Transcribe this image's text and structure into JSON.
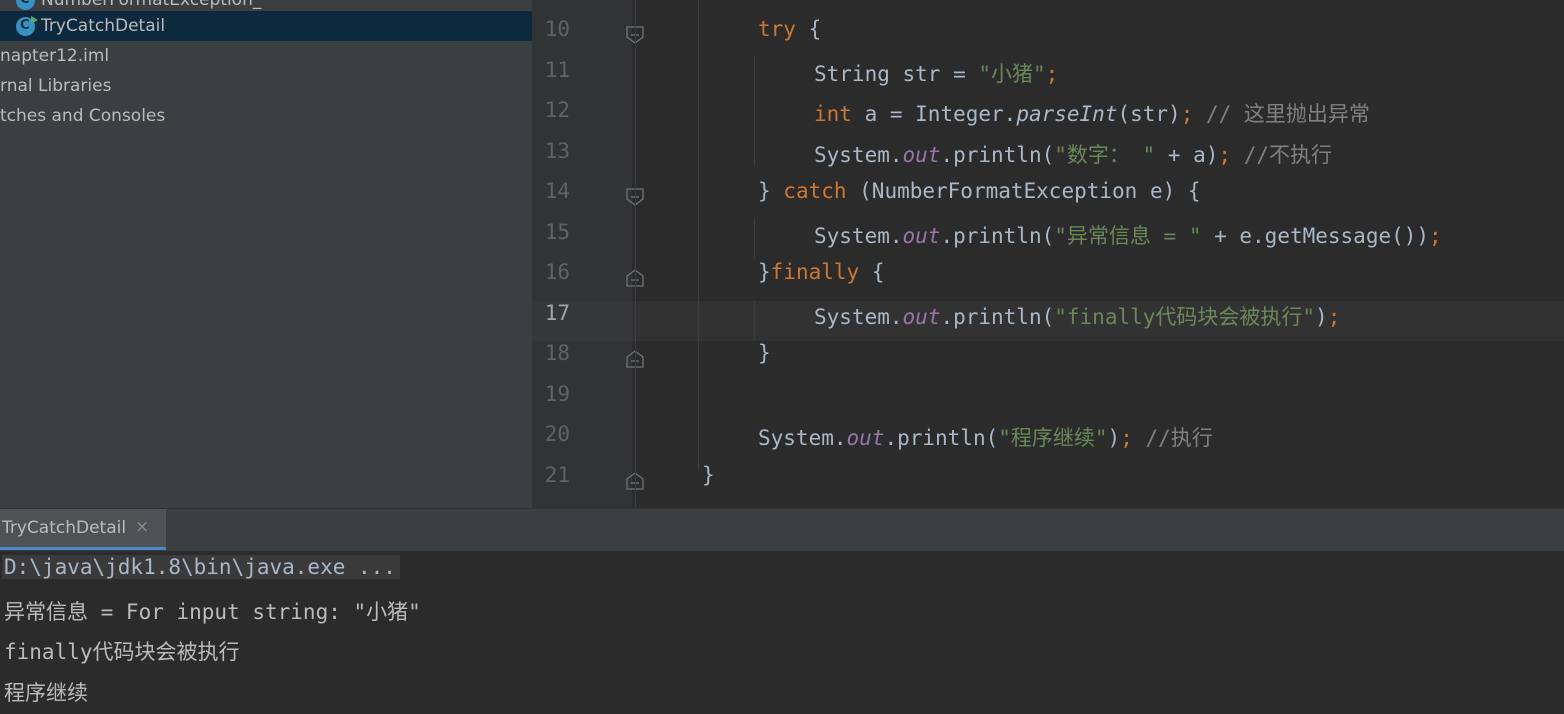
{
  "project_tree": {
    "items": [
      {
        "label": "NumberFormatException_",
        "kind": "class"
      },
      {
        "label": "TryCatchDetail",
        "kind": "class",
        "selected": true
      },
      {
        "label": "napter12.iml"
      },
      {
        "label": "rnal Libraries"
      },
      {
        "label": "tches and Consoles"
      }
    ]
  },
  "editor": {
    "current_line": 17,
    "lines": [
      {
        "num": "10",
        "tokens": [
          {
            "t": "try",
            "c": "kw"
          },
          {
            "t": " {",
            "c": ""
          }
        ]
      },
      {
        "num": "11",
        "tokens": [
          {
            "t": "String str = ",
            "c": ""
          },
          {
            "t": "\"小猪\"",
            "c": "str"
          },
          {
            "t": ";",
            "c": "semi"
          }
        ]
      },
      {
        "num": "12",
        "tokens": [
          {
            "t": "int",
            "c": "kw"
          },
          {
            "t": " a = Integer.",
            "c": ""
          },
          {
            "t": "parseInt",
            "c": "sm"
          },
          {
            "t": "(str)",
            "c": ""
          },
          {
            "t": ";",
            "c": "semi"
          },
          {
            "t": " // 这里抛出异常",
            "c": "cm"
          }
        ]
      },
      {
        "num": "13",
        "tokens": [
          {
            "t": "System.",
            "c": ""
          },
          {
            "t": "out",
            "c": "fld"
          },
          {
            "t": ".println(",
            "c": ""
          },
          {
            "t": "\"数字： \"",
            "c": "str"
          },
          {
            "t": " + a)",
            "c": ""
          },
          {
            "t": ";",
            "c": "semi"
          },
          {
            "t": " //不执行",
            "c": "cm"
          }
        ]
      },
      {
        "num": "14",
        "tokens": [
          {
            "t": "} ",
            "c": ""
          },
          {
            "t": "catch",
            "c": "kw"
          },
          {
            "t": " (NumberFormatException e) {",
            "c": ""
          }
        ]
      },
      {
        "num": "15",
        "tokens": [
          {
            "t": "System.",
            "c": ""
          },
          {
            "t": "out",
            "c": "fld"
          },
          {
            "t": ".println(",
            "c": ""
          },
          {
            "t": "\"异常信息 = \"",
            "c": "str"
          },
          {
            "t": " + e.getMessage())",
            "c": ""
          },
          {
            "t": ";",
            "c": "semi"
          }
        ]
      },
      {
        "num": "16",
        "tokens": [
          {
            "t": "}",
            "c": ""
          },
          {
            "t": "finally",
            "c": "kw"
          },
          {
            "t": " {",
            "c": ""
          }
        ]
      },
      {
        "num": "17",
        "tokens": [
          {
            "t": "System.",
            "c": ""
          },
          {
            "t": "out",
            "c": "fld"
          },
          {
            "t": ".println(",
            "c": ""
          },
          {
            "t": "\"finally代码块会被执行\"",
            "c": "str"
          },
          {
            "t": ")",
            "c": ""
          },
          {
            "t": ";",
            "c": "semi"
          }
        ]
      },
      {
        "num": "18",
        "tokens": [
          {
            "t": "}",
            "c": ""
          }
        ]
      },
      {
        "num": "19",
        "tokens": []
      },
      {
        "num": "20",
        "tokens": [
          {
            "t": "System.",
            "c": ""
          },
          {
            "t": "out",
            "c": "fld"
          },
          {
            "t": ".println(",
            "c": ""
          },
          {
            "t": "\"程序继续\"",
            "c": "str"
          },
          {
            "t": ")",
            "c": ""
          },
          {
            "t": ";",
            "c": "semi"
          },
          {
            "t": " //执行",
            "c": "cm"
          }
        ]
      },
      {
        "num": "21",
        "tokens": [
          {
            "t": "}",
            "c": ""
          }
        ]
      }
    ]
  },
  "run_panel": {
    "tab_label": "TryCatchDetail",
    "close_glyph": "×",
    "output": [
      "D:\\java\\jdk1.8\\bin\\java.exe ...",
      "异常信息 = For input string: \"小猪\"",
      "finally代码块会被执行",
      "程序继续"
    ]
  },
  "colors": {
    "keyword": "#cc7832",
    "string": "#6a8759",
    "comment": "#808080",
    "field": "#9876aa",
    "selection": "#0d293e",
    "tab_underline": "#4a88c7"
  }
}
